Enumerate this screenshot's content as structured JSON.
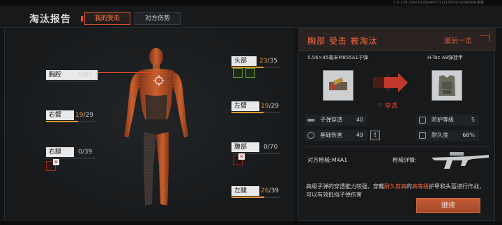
{
  "build_info": "1.0.126.126(S)|2024/07/21|17|03|01|0A3E4|高速",
  "header": {
    "title": "淘汰报告",
    "tabs": [
      {
        "label": "我的受击",
        "active": true
      },
      {
        "label": "对方伤势",
        "active": false
      }
    ]
  },
  "body_parts": {
    "chest": {
      "label": "胸腔",
      "value": "0/85",
      "current": "0",
      "max": "85"
    },
    "right_arm": {
      "label": "右臂",
      "current": "19",
      "max": "29"
    },
    "right_leg": {
      "label": "右腿",
      "current": "0",
      "max": "39"
    },
    "head": {
      "label": "头部",
      "current": "23",
      "max": "35"
    },
    "left_arm": {
      "label": "左臂",
      "current": "19",
      "max": "29"
    },
    "abdomen": {
      "label": "腹部",
      "current": "0",
      "max": "70"
    },
    "left_leg": {
      "label": "左腿",
      "current": "26",
      "max": "39"
    }
  },
  "kill_info": {
    "headline": "胸部 受击 被淘汰",
    "last_hit": "最后一击",
    "ammo_name": "5.56×45毫米M855A1子弹",
    "armor_name": "H-Tac A8弹挂甲",
    "result": "穿透",
    "ammo_stats": [
      {
        "label": "子弹穿透",
        "value": "40"
      },
      {
        "label": "基础伤害",
        "value": "49"
      }
    ],
    "armor_stats": [
      {
        "label": "防护等级",
        "value": "5"
      },
      {
        "label": "耐久度",
        "value": "68%"
      }
    ],
    "enemy_weapon_label": "对方枪械:",
    "enemy_weapon": "M4A1",
    "weapon_detail_label": "枪械详情:",
    "description_pre": "高级子弹的穿透能力较强，穿戴",
    "description_hl1": "耐久度高",
    "description_mid": "的",
    "description_hl2": "高等级",
    "description_post": "护甲和头盔进行作战，可以有效抵挡子弹伤害",
    "continue_label": "继续"
  },
  "colors": {
    "accent": "#e0552e",
    "health_orange": "#e39a2c",
    "panel_bg": "#17191b"
  }
}
